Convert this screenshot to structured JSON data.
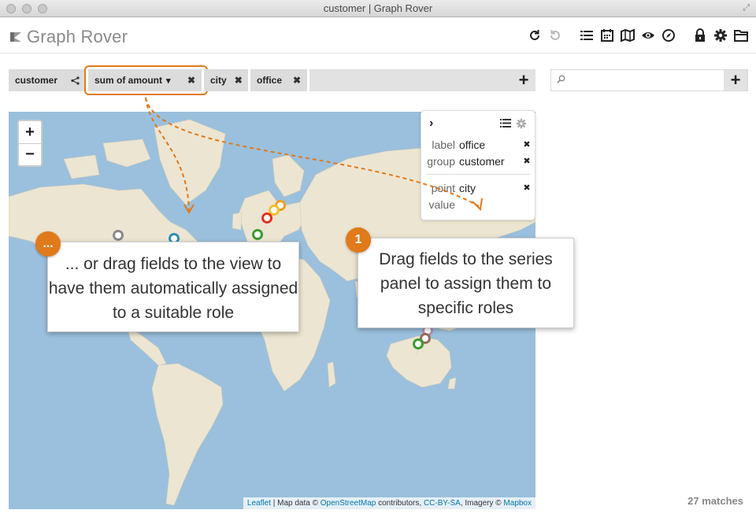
{
  "window": {
    "title": "customer | Graph Rover"
  },
  "app": {
    "name": "Graph Rover"
  },
  "toolbar": {
    "icons": [
      "refresh-icon",
      "redo-icon",
      "list-icon",
      "calendar-icon",
      "map-icon",
      "eye-icon",
      "compass-icon",
      "lock-icon",
      "gear-icon",
      "folder-icon"
    ]
  },
  "fields": [
    {
      "label": "customer",
      "action": "share-icon"
    },
    {
      "label": "sum of amount",
      "dropdown": "▾",
      "action": "✖"
    },
    {
      "label": "city",
      "action": "✖"
    },
    {
      "label": "office",
      "action": "✖"
    }
  ],
  "search": {
    "placeholder": ""
  },
  "series_panel": {
    "expand": "›",
    "rows": [
      {
        "key": "label",
        "value": "office",
        "remove": "✖"
      },
      {
        "key": "group",
        "value": "customer",
        "remove": "✖"
      },
      {
        "key": "point",
        "value": "city",
        "remove": "✖"
      },
      {
        "key": "value",
        "value": "",
        "remove": ""
      }
    ]
  },
  "callouts": {
    "left": {
      "badge": "...",
      "text": "... or drag fields to the view to have them automatically assigned to a suitable role"
    },
    "right": {
      "badge": "1",
      "text": "Drag fields to the series panel to assign them to specific roles"
    }
  },
  "map": {
    "zoom_in": "+",
    "zoom_out": "−",
    "attribution": {
      "leaflet": "Leaflet",
      "text1": " | Map data © ",
      "osm": "OpenStreetMap",
      "text2": " contributors, ",
      "license": "CC-BY-SA",
      "text3": ", Imagery © ",
      "mapbox": "Mapbox"
    }
  },
  "status": {
    "matches": "27 matches"
  },
  "colors": {
    "accent": "#e07a1a",
    "water": "#9ac0dd",
    "land": "#ece5d2"
  }
}
